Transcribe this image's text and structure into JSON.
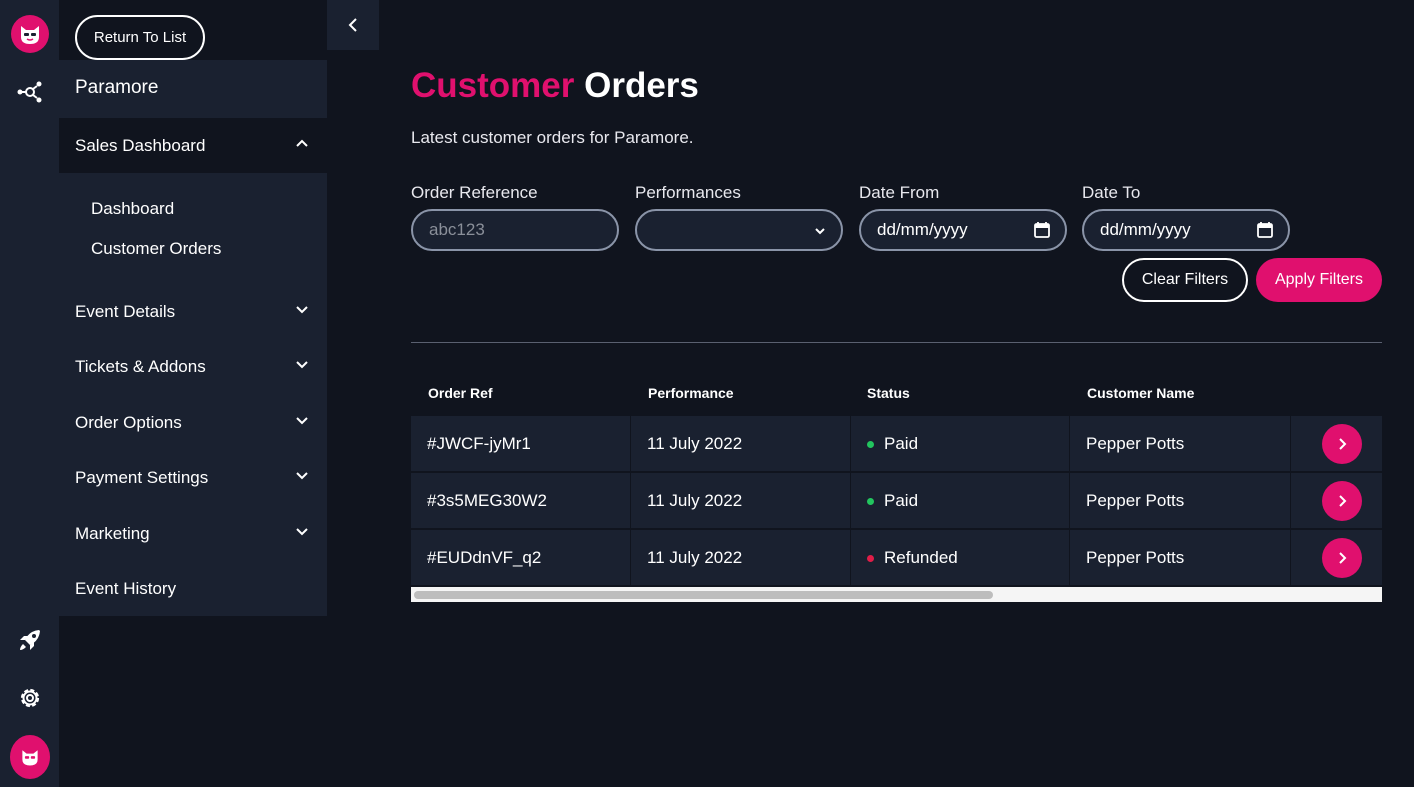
{
  "sidebar": {
    "return_label": "Return To List",
    "event_name": "Paramore",
    "section_open": "Sales Dashboard",
    "sub_items": [
      "Dashboard",
      "Customer Orders"
    ],
    "sections": [
      "Event Details",
      "Tickets & Addons",
      "Order Options",
      "Payment Settings",
      "Marketing",
      "Event History"
    ]
  },
  "rail": {
    "icons": [
      "logo-icon",
      "network-icon",
      "rocket-icon",
      "gear-icon",
      "avatar-icon"
    ]
  },
  "header": {
    "title_accent": "Customer",
    "title_rest": "Orders",
    "subtitle": "Latest customer orders for Paramore."
  },
  "filters": {
    "order_ref_label": "Order Reference",
    "order_ref_placeholder": "abc123",
    "performances_label": "Performances",
    "performances_value": "",
    "date_from_label": "Date From",
    "date_from_value": "dd/mm/yyyy",
    "date_to_label": "Date To",
    "date_to_value": "dd/mm/yyyy",
    "clear_label": "Clear Filters",
    "apply_label": "Apply Filters"
  },
  "table": {
    "headers": [
      "Order Ref",
      "Performance",
      "Status",
      "Customer Name"
    ],
    "rows": [
      {
        "ref": "#JWCF-jyMr1",
        "performance": "11 July 2022",
        "status": "Paid",
        "customer": "Pepper Potts"
      },
      {
        "ref": "#3s5MEG30W2",
        "performance": "11 July 2022",
        "status": "Paid",
        "customer": "Pepper Potts"
      },
      {
        "ref": "#EUDdnVF_q2",
        "performance": "11 July 2022",
        "status": "Refunded",
        "customer": "Pepper Potts"
      }
    ],
    "scroll_fraction": 0.6
  },
  "colors": {
    "accent": "#e0106e",
    "paid": "#22c55e",
    "refunded": "#e11d48",
    "background": "#10141e",
    "panel": "#1a2130"
  }
}
